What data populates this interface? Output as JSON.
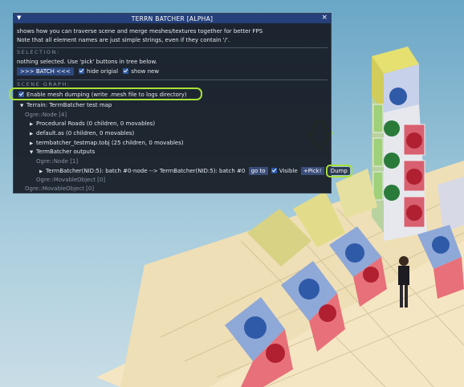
{
  "window": {
    "title": "TERRN BATCHER [ALPHA]",
    "close_glyph": "×",
    "collapse_glyph": "▼"
  },
  "intro": {
    "line1": "shows how you can traverse scene and merge meshes/textures together for better FPS",
    "line2": "Note that all element names are just simple strings, even if they contain '/'."
  },
  "selection": {
    "heading": "SELECTION:",
    "status": "nothing selected. Use 'pick' buttons in tree below.",
    "batch_label": ">>> BATCH <<<",
    "hide_original_label": "hide origial",
    "show_new_label": "show new"
  },
  "scene_graph": {
    "heading": "SCENE GRAPH:",
    "mesh_dump_label": "Enable mesh dumping (write .mesh file to logs directory)",
    "terrain_label": "Terrain: TerrnBatcher test map",
    "ogre_node4": "Ogre::Node [4]",
    "items": [
      "Procedural Roads  (0 children, 0 movables)",
      "default.as  (0 children, 0 movables)",
      "termbatcher_testmap.tobj  (25 children, 0 movables)",
      "TermBatcher outputs"
    ],
    "ogre_node1": "Ogre::Node [1]",
    "batch_entry": "TerrnBatcher(NID:5): batch #0-node --> TerrnBatcher(NID:5): batch #0",
    "goto_label": "go to",
    "visible_label": "Visible",
    "pick_label": "+Pick!",
    "dump_label": "Dump",
    "movable_inner": "Ogre::MovableObject [0]",
    "movable_outer": "Ogre::MovableObject [0]"
  },
  "colors": {
    "highlight": "#a8e03a",
    "titlebar": "#25407a",
    "panel_bg": "#161b24"
  },
  "icons": [
    "collapse-triangle-icon",
    "close-icon",
    "checkbox-icon",
    "tree-arrow-icon",
    "down-arrow-annotation-icon"
  ]
}
